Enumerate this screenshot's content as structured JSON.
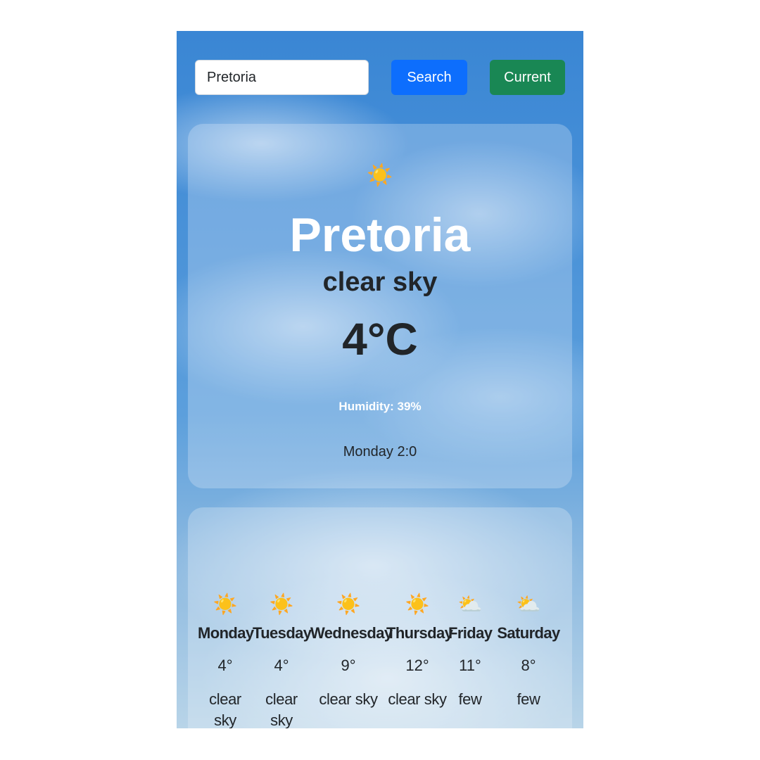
{
  "search": {
    "value": "Pretoria",
    "search_label": "Search",
    "current_label": "Current"
  },
  "current": {
    "icon": "☀️",
    "icon_name": "sun-icon",
    "city": "Pretoria",
    "description": "clear sky",
    "temperature": "4°C",
    "humidity_label": "Humidity:",
    "humidity_value": "39%",
    "time": "Monday 2:0"
  },
  "forecast": [
    {
      "icon": "☀️",
      "icon_name": "sun-icon",
      "day": "Monday",
      "temp": "4°",
      "desc": "clear sky"
    },
    {
      "icon": "☀️",
      "icon_name": "sun-icon",
      "day": "Tuesday",
      "temp": "4°",
      "desc": "clear sky"
    },
    {
      "icon": "☀️",
      "icon_name": "sun-icon",
      "day": "Wednesday",
      "temp": "9°",
      "desc": "clear sky"
    },
    {
      "icon": "☀️",
      "icon_name": "sun-icon",
      "day": "Thursday",
      "temp": "12°",
      "desc": "clear sky"
    },
    {
      "icon": "⛅",
      "icon_name": "partly-cloudy-icon",
      "day": "Friday",
      "temp": "11°",
      "desc": "few"
    },
    {
      "icon": "⛅",
      "icon_name": "partly-cloudy-icon",
      "day": "Saturday",
      "temp": "8°",
      "desc": "few"
    }
  ],
  "colors": {
    "search_button": "#0d6efd",
    "current_button": "#198754",
    "sky": "#4a92d8"
  }
}
